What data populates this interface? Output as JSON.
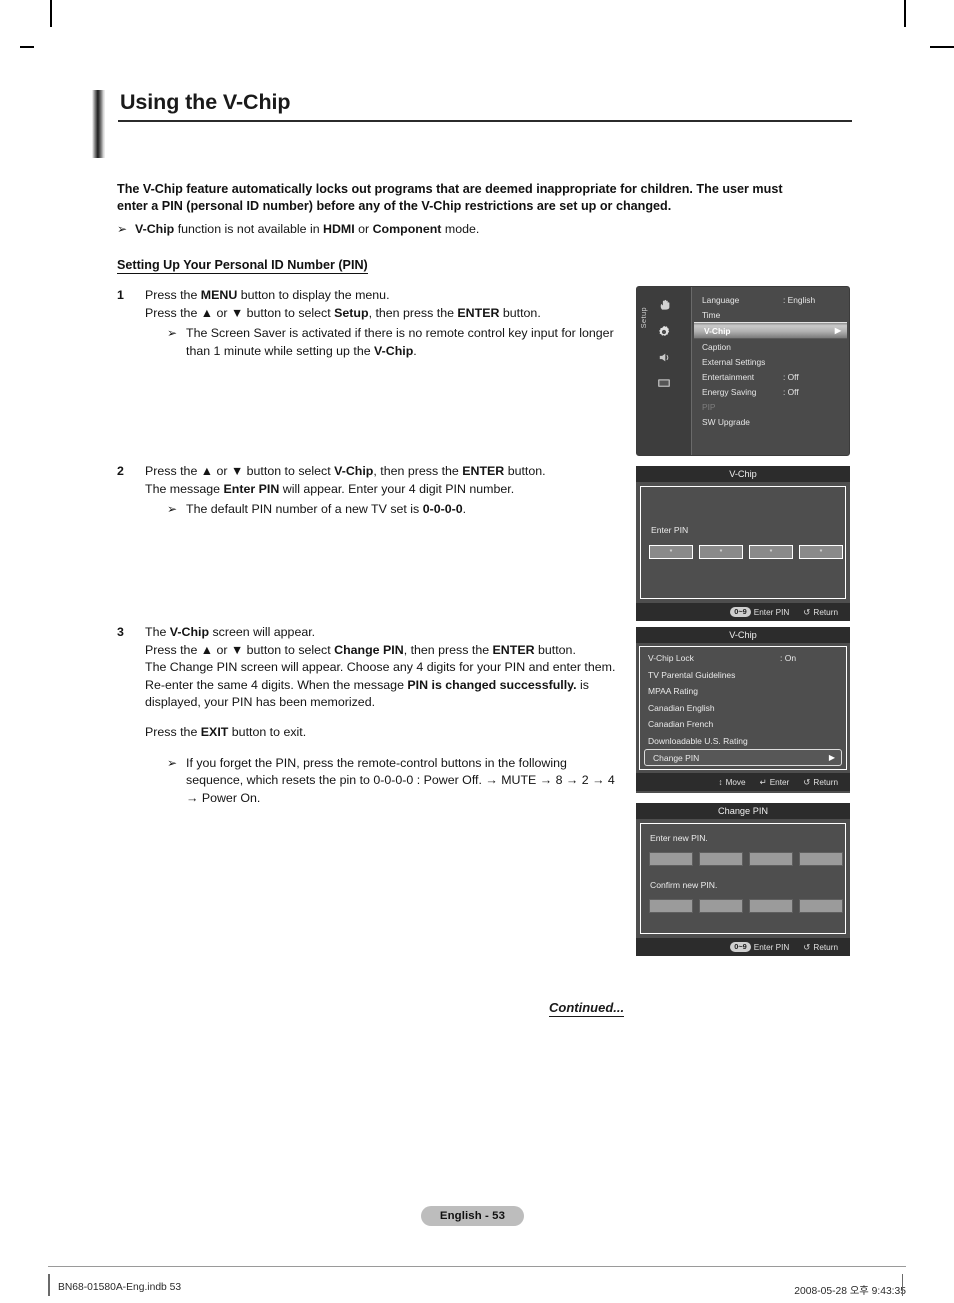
{
  "page": {
    "title": "Using the V-Chip",
    "badge": "English - 53",
    "continued": "Continued...",
    "footer_left": "BN68-01580A-Eng.indb   53",
    "footer_right": "2008-05-28   오후 9:43:35"
  },
  "intro": {
    "paragraph_a": "The V-Chip feature automatically locks out programs that are deemed inappropriate for children. The user must",
    "paragraph_b": "enter a PIN (personal ID number) before any of the V-Chip restrictions are set up or changed.",
    "bullet_mark": "➢",
    "bullet_1_a": "V-Chip",
    "bullet_1_b": " function is not available in ",
    "bullet_1_c": "HDMI",
    "bullet_1_d": " or ",
    "bullet_1_e": "Component",
    "bullet_1_f": " mode.",
    "section_head": "Setting Up Your Personal ID Number (PIN)"
  },
  "steps": [
    {
      "num": "1",
      "l1_a": "Press the ",
      "l1_b": "MENU",
      "l1_c": " button to display the menu.",
      "l2_a": "Press the ▲ or ▼ button to select ",
      "l2_b": "Setup",
      "l2_c": ", then press the ",
      "l2_d": "ENTER",
      "l2_e": " button.",
      "sub_a": "The Screen Saver is activated if there is no remote control key input for longer than 1 minute while setting up the ",
      "sub_b": "V-Chip",
      "sub_c": "."
    },
    {
      "num": "2",
      "l1_a": "Press the ▲ or ▼ button to select ",
      "l1_b": "V-Chip",
      "l1_c": ", then press the ",
      "l1_d": "ENTER",
      "l1_e": " button.",
      "l2_a": "The message ",
      "l2_b": "Enter PIN",
      "l2_c": " will appear. Enter your 4 digit PIN number.",
      "sub_a": "The default PIN number of a new TV set is ",
      "sub_b": "0-0-0-0",
      "sub_c": "."
    },
    {
      "num": "3",
      "l1_a": "The ",
      "l1_b": "V-Chip",
      "l1_c": " screen will appear.",
      "l2_a": "Press the ▲ or ▼ button to select ",
      "l2_b": "Change PIN",
      "l2_c": ", then press the ",
      "l2_d": "ENTER",
      "l2_e": " button.",
      "l3_a": "The Change PIN screen will appear. Choose any 4 digits for your PIN and enter them. Re-enter the same 4 digits. When the message ",
      "l3_b": "PIN is changed successfully.",
      "l3_c": " is displayed, your PIN has been memorized.",
      "para2_a": "Press the ",
      "para2_b": "EXIT",
      "para2_c": " button to exit.",
      "sub_a": "If you forget the PIN, press the remote-control buttons in the following sequence, which resets the pin to 0-0-0-0 : Power Off. → MUTE → 8 → 2 → 4 → Power On."
    }
  ],
  "osd_setup": {
    "rail_label": "Setup",
    "icons": [
      "hand-icon",
      "gear-icon",
      "speaker-icon",
      "screen-icon"
    ],
    "rows": [
      {
        "label": "Language",
        "value": ": English",
        "state": "normal"
      },
      {
        "label": "Time",
        "value": "",
        "state": "normal"
      },
      {
        "label": "V-Chip",
        "value": "",
        "state": "selected",
        "arrow": "▶"
      },
      {
        "label": "Caption",
        "value": "",
        "state": "normal"
      },
      {
        "label": "External Settings",
        "value": "",
        "state": "normal"
      },
      {
        "label": "Entertainment",
        "value": ": Off",
        "state": "normal"
      },
      {
        "label": "Energy Saving",
        "value": ": Off",
        "state": "normal"
      },
      {
        "label": "PIP",
        "value": "",
        "state": "dim"
      },
      {
        "label": "SW Upgrade",
        "value": "",
        "state": "normal"
      }
    ]
  },
  "osd_enter_pin": {
    "title": "V-Chip",
    "label": "Enter PIN",
    "boxes": [
      "*",
      "*",
      "*",
      "*"
    ],
    "foot": [
      {
        "pill": "0~9",
        "text": "Enter PIN"
      },
      {
        "glyph": "↺",
        "text": "Return"
      }
    ]
  },
  "osd_vchip": {
    "title": "V-Chip",
    "rows": [
      {
        "label": "V-Chip Lock",
        "value": ": On",
        "state": "normal"
      },
      {
        "label": "TV Parental Guidelines",
        "value": "",
        "state": "normal"
      },
      {
        "label": "MPAA Rating",
        "value": "",
        "state": "normal"
      },
      {
        "label": "Canadian English",
        "value": "",
        "state": "normal"
      },
      {
        "label": "Canadian French",
        "value": "",
        "state": "normal"
      },
      {
        "label": "Downloadable U.S. Rating",
        "value": "",
        "state": "normal"
      },
      {
        "label": "Change PIN",
        "value": "",
        "state": "selected",
        "arrow": "▶"
      }
    ],
    "foot": [
      {
        "glyph": "↕",
        "text": "Move"
      },
      {
        "glyph": "↵",
        "text": "Enter"
      },
      {
        "glyph": "↺",
        "text": "Return"
      }
    ]
  },
  "osd_change_pin": {
    "title": "Change PIN",
    "label_new": "Enter new PIN.",
    "label_confirm": "Confirm new PIN.",
    "boxes_new": [
      "",
      "",
      "",
      ""
    ],
    "boxes_confirm": [
      "",
      "",
      "",
      ""
    ],
    "foot": [
      {
        "pill": "0~9",
        "text": "Enter PIN"
      },
      {
        "glyph": "↺",
        "text": "Return"
      }
    ]
  },
  "colors": {
    "osd_bg": "#4e4e4e",
    "osd_title_bg": "#2c2c2c",
    "badge_bg": "#bdbdbd",
    "rule": "#2b2b2b"
  }
}
